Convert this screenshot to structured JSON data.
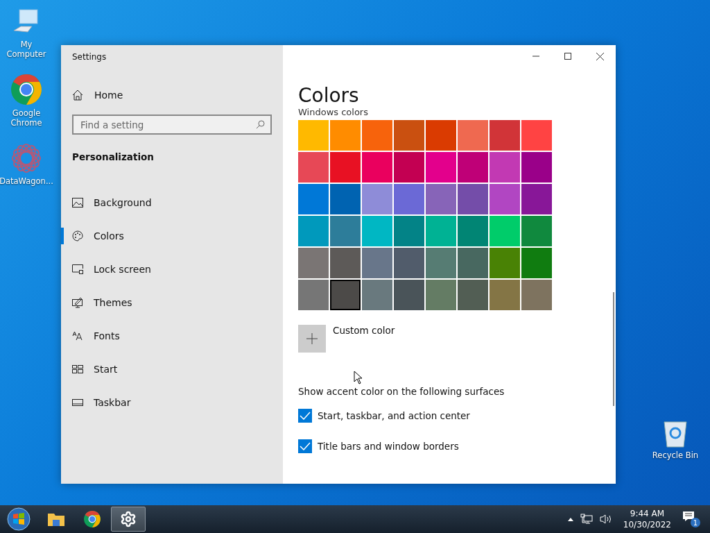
{
  "desktop": {
    "icons": [
      {
        "kind": "computer",
        "label": "My Computer"
      },
      {
        "kind": "chrome",
        "label": "Google Chrome"
      },
      {
        "kind": "app",
        "label": "DataWagon..."
      },
      {
        "kind": "bin",
        "label": "Recycle Bin"
      }
    ]
  },
  "window": {
    "title": "Settings"
  },
  "sidebar": {
    "home": "Home",
    "search": {
      "placeholder": "Find a setting"
    },
    "section": "Personalization",
    "items": [
      {
        "label": "Background",
        "selected": false
      },
      {
        "label": "Colors",
        "selected": true
      },
      {
        "label": "Lock screen",
        "selected": false
      },
      {
        "label": "Themes",
        "selected": false
      },
      {
        "label": "Fonts",
        "selected": false
      },
      {
        "label": "Start",
        "selected": false
      },
      {
        "label": "Taskbar",
        "selected": false
      }
    ]
  },
  "content": {
    "title": "Colors",
    "subtitle": "Windows colors",
    "swatches": [
      {
        "color": "#ffb900",
        "selected": false
      },
      {
        "color": "#ff8c00",
        "selected": false
      },
      {
        "color": "#f7630c",
        "selected": false
      },
      {
        "color": "#ca5010",
        "selected": false
      },
      {
        "color": "#da3b01",
        "selected": false
      },
      {
        "color": "#ef6950",
        "selected": false
      },
      {
        "color": "#d13438",
        "selected": false
      },
      {
        "color": "#ff4343",
        "selected": false
      },
      {
        "color": "#e74856",
        "selected": false
      },
      {
        "color": "#e81123",
        "selected": false
      },
      {
        "color": "#ea005e",
        "selected": false
      },
      {
        "color": "#c30052",
        "selected": false
      },
      {
        "color": "#e3008c",
        "selected": false
      },
      {
        "color": "#bf0077",
        "selected": false
      },
      {
        "color": "#c239b3",
        "selected": false
      },
      {
        "color": "#9a0089",
        "selected": false
      },
      {
        "color": "#0078d7",
        "selected": false
      },
      {
        "color": "#0063b1",
        "selected": false
      },
      {
        "color": "#8e8cd8",
        "selected": false
      },
      {
        "color": "#6b69d6",
        "selected": false
      },
      {
        "color": "#8764b8",
        "selected": false
      },
      {
        "color": "#744da9",
        "selected": false
      },
      {
        "color": "#b146c2",
        "selected": false
      },
      {
        "color": "#881798",
        "selected": false
      },
      {
        "color": "#0099bc",
        "selected": false
      },
      {
        "color": "#2d7d9a",
        "selected": false
      },
      {
        "color": "#00b7c3",
        "selected": false
      },
      {
        "color": "#038387",
        "selected": false
      },
      {
        "color": "#00b294",
        "selected": false
      },
      {
        "color": "#018574",
        "selected": false
      },
      {
        "color": "#00cc6a",
        "selected": false
      },
      {
        "color": "#10893e",
        "selected": false
      },
      {
        "color": "#7a7574",
        "selected": false
      },
      {
        "color": "#5d5a58",
        "selected": false
      },
      {
        "color": "#68768a",
        "selected": false
      },
      {
        "color": "#515c6b",
        "selected": false
      },
      {
        "color": "#567c73",
        "selected": false
      },
      {
        "color": "#486860",
        "selected": false
      },
      {
        "color": "#498205",
        "selected": false
      },
      {
        "color": "#107c10",
        "selected": false
      },
      {
        "color": "#767676",
        "selected": false
      },
      {
        "color": "#4c4a48",
        "selected": true
      },
      {
        "color": "#69797e",
        "selected": false
      },
      {
        "color": "#4a5459",
        "selected": false
      },
      {
        "color": "#647c64",
        "selected": false
      },
      {
        "color": "#525e54",
        "selected": false
      },
      {
        "color": "#847545",
        "selected": false
      },
      {
        "color": "#7e735f",
        "selected": false
      }
    ],
    "custom_color": "Custom color",
    "surfaces_heading": "Show accent color on the following surfaces",
    "checkboxes": [
      {
        "label": "Start, taskbar, and action center",
        "checked": true
      },
      {
        "label": "Title bars and window borders",
        "checked": true
      }
    ]
  },
  "taskbar": {
    "apps": [
      {
        "kind": "start",
        "selected": false
      },
      {
        "kind": "folder",
        "selected": false
      },
      {
        "kind": "chrome",
        "selected": false
      },
      {
        "kind": "settings",
        "selected": true
      }
    ],
    "time": "9:44 AM",
    "date": "10/30/2022",
    "notifications": "1"
  }
}
